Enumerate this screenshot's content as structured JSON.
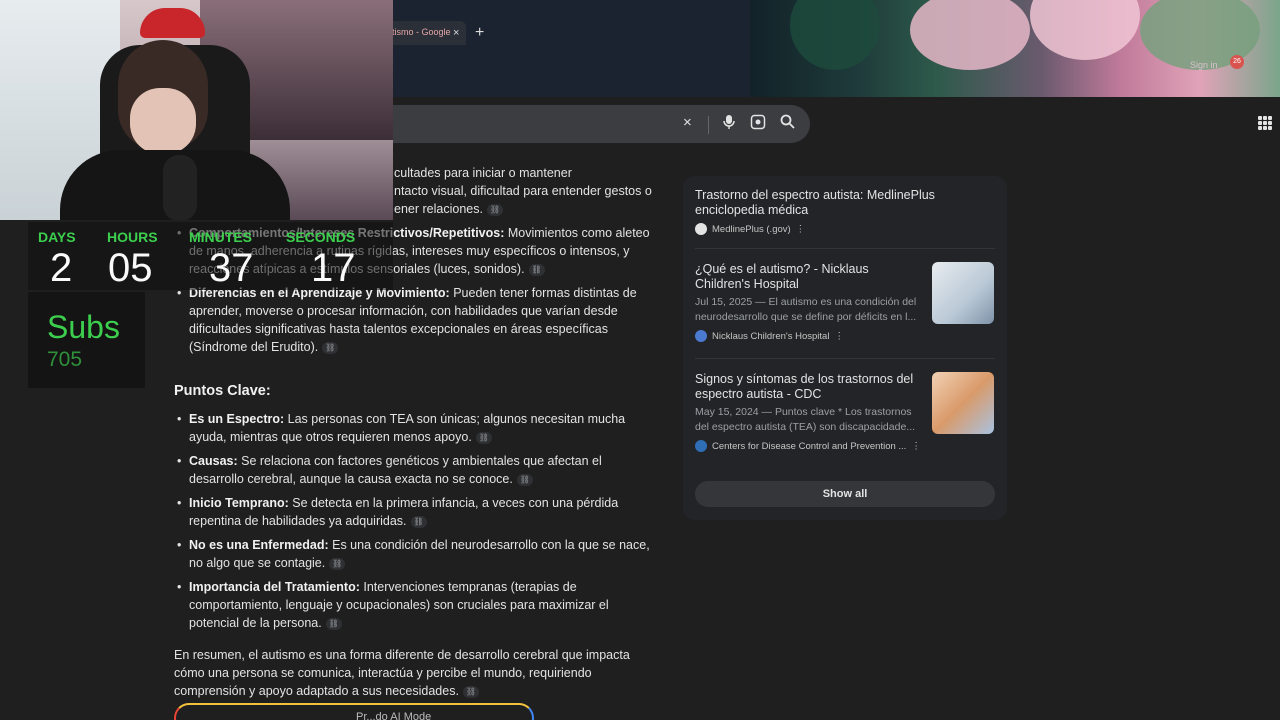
{
  "browser": {
    "tab_title": "tismo - Google",
    "tab_close": "×",
    "new_tab": "+",
    "sign_in": "Sign in",
    "avatar_badge": "26"
  },
  "search": {
    "clear_icon": "×",
    "mic_icon": "mic-icon",
    "lens_icon": "lens-icon",
    "search_icon": "search-icon"
  },
  "main": {
    "intro_text": "cultades para iniciar o mantener",
    "intro_text_2": "ntacto visual, dificultad para entender gestos o",
    "intro_text_3": "ener relaciones.",
    "bullet_1_bold": "Comportamientos/Intereses Restrictivos/Repetitivos:",
    "bullet_1_text": "Movimientos como aleteo de manos, adherencia a rutinas rígidas, intereses muy específicos o intensos, y reacciones atípicas a estímulos sensoriales (luces, sonidos).",
    "bullet_2_bold": "Diferencias en el Aprendizaje y Movimiento:",
    "bullet_2_text": "Pueden tener formas distintas de aprender, moverse o procesar información, con habilidades que varían desde dificultades significativas hasta talentos excepcionales en áreas específicas (Síndrome del Erudito).",
    "heading": "Puntos Clave:",
    "points": [
      {
        "bold": "Es un Espectro:",
        "text": "Las personas con TEA son únicas; algunos necesitan mucha ayuda, mientras que otros requieren menos apoyo."
      },
      {
        "bold": "Causas:",
        "text": "Se relaciona con factores genéticos y ambientales que afectan el desarrollo cerebral, aunque la causa exacta no se conoce."
      },
      {
        "bold": "Inicio Temprano:",
        "text": "Se detecta en la primera infancia, a veces con una pérdida repentina de habilidades ya adquiridas."
      },
      {
        "bold": "No es una Enfermedad:",
        "text": "Es una condición del neurodesarrollo con la que se nace, no algo que se contagie."
      },
      {
        "bold": "Importancia del Tratamiento:",
        "text": "Intervenciones tempranas (terapias de comportamiento, lenguaje y ocupacionales) son cruciales para maximizar el potencial de la persona."
      }
    ],
    "summary": "En resumen, el autismo es una forma diferente de desarrollo cerebral que impacta cómo una persona se comunica, interactúa y percibe el mundo, requiriendo comprensión y apoyo adaptado a sus necesidades.",
    "bottom_chip": "Pr...do AI Mode"
  },
  "sources": {
    "items": [
      {
        "title": "Trastorno del espectro autista: MedlinePlus enciclopedia médica",
        "desc": "",
        "site": "MedlinePlus (.gov)"
      },
      {
        "title": "¿Qué es el autismo? - Nicklaus Children's Hospital",
        "desc": "Jul 15, 2025 — El autismo es una condición del neurodesarrollo que se define por déficits en l...",
        "site": "Nicklaus Children's Hospital"
      },
      {
        "title": "Signos y síntomas de los trastornos del espectro autista - CDC",
        "desc": "May 15, 2024 — Puntos clave * Los trastornos del espectro autista (TEA) son discapacidade...",
        "site": "Centers for Disease Control and Prevention ..."
      }
    ],
    "show_all": "Show all"
  },
  "overlay": {
    "days_label": "DAYS",
    "days": "2",
    "hours_label": "HOURS",
    "hours": "05",
    "minutes_label": "MINUTES",
    "minutes": "37",
    "seconds_label": "SECONDS",
    "seconds": "17",
    "subs_label": "Subs",
    "subs": "705"
  },
  "colors": {
    "accent_green": "#3ccf4e",
    "page_bg": "#1f1f1f",
    "panel_bg": "#232427"
  }
}
